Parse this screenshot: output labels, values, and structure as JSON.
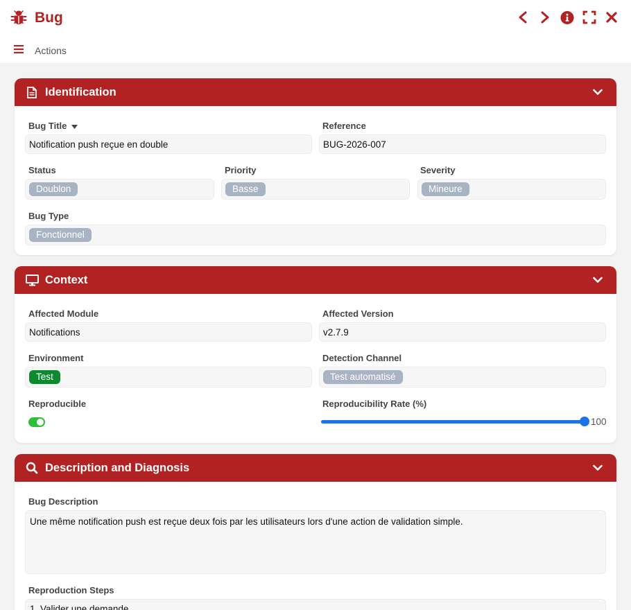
{
  "app": {
    "title": "Bug",
    "brand_color": "#b22222",
    "icon": "bug-icon"
  },
  "toolbar": {
    "actions_label": "Actions"
  },
  "window_controls": [
    "chevron-left-icon",
    "chevron-right-icon",
    "info-icon",
    "fullscreen-icon",
    "close-icon"
  ],
  "identification": {
    "title": "Identification",
    "bug_title": {
      "label": "Bug Title",
      "value": "Notification push reçue en double"
    },
    "reference": {
      "label": "Reference",
      "value": "BUG-2026-007"
    },
    "status": {
      "label": "Status",
      "value": "Doublon"
    },
    "priority": {
      "label": "Priority",
      "value": "Basse"
    },
    "severity": {
      "label": "Severity",
      "value": "Mineure"
    },
    "bug_type": {
      "label": "Bug Type",
      "value": "Fonctionnel"
    }
  },
  "context": {
    "title": "Context",
    "affected_module": {
      "label": "Affected Module",
      "value": "Notifications"
    },
    "affected_version": {
      "label": "Affected Version",
      "value": "v2.7.9"
    },
    "environment": {
      "label": "Environment",
      "value": "Test"
    },
    "detection_channel": {
      "label": "Detection Channel",
      "value": "Test automatisé"
    },
    "reproducible": {
      "label": "Reproducible",
      "checked": true
    },
    "reproducibility_rate": {
      "label": "Reproducibility Rate (%)",
      "value": 100,
      "value_text": "100"
    }
  },
  "description": {
    "title": "Description and Diagnosis",
    "bug_description": {
      "label": "Bug Description",
      "value": "Une même notification push est reçue deux fois par les utilisateurs lors d'une action de validation simple."
    },
    "reproduction_steps": {
      "label": "Reproduction Steps",
      "value": "1. Valider une demande"
    }
  }
}
